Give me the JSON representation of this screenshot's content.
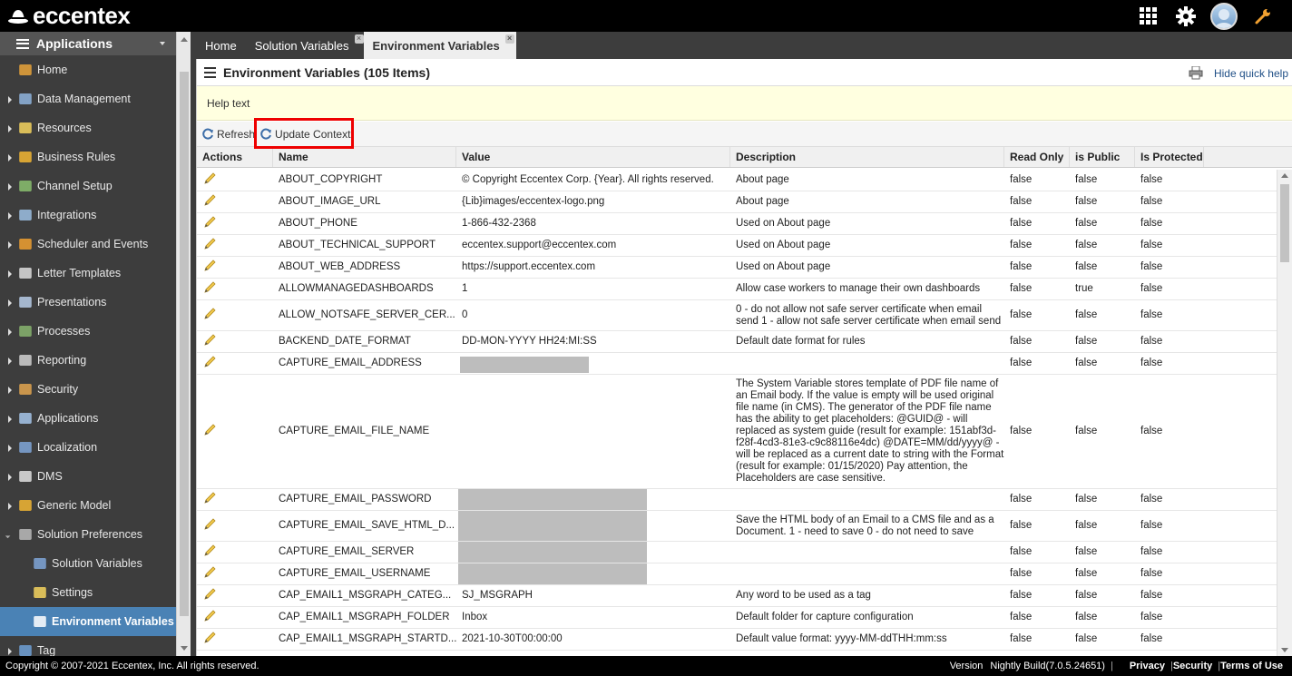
{
  "app": {
    "logo_text": "eccentex"
  },
  "sidebar": {
    "header": "Applications",
    "items": [
      {
        "label": "Home",
        "expandable": false
      },
      {
        "label": "Data Management",
        "expandable": true
      },
      {
        "label": "Resources",
        "expandable": true
      },
      {
        "label": "Business Rules",
        "expandable": true
      },
      {
        "label": "Channel Setup",
        "expandable": true
      },
      {
        "label": "Integrations",
        "expandable": true
      },
      {
        "label": "Scheduler and Events",
        "expandable": true
      },
      {
        "label": "Letter Templates",
        "expandable": true
      },
      {
        "label": "Presentations",
        "expandable": true
      },
      {
        "label": "Processes",
        "expandable": true
      },
      {
        "label": "Reporting",
        "expandable": true
      },
      {
        "label": "Security",
        "expandable": true
      },
      {
        "label": "Applications",
        "expandable": true
      },
      {
        "label": "Localization",
        "expandable": true
      },
      {
        "label": "DMS",
        "expandable": true
      },
      {
        "label": "Generic Model",
        "expandable": true
      },
      {
        "label": "Solution Preferences",
        "expandable": true
      },
      {
        "label": "Solution Variables",
        "sub": true
      },
      {
        "label": "Settings",
        "sub": true
      },
      {
        "label": "Environment Variables",
        "sub": true,
        "active": true
      },
      {
        "label": "Tag",
        "expandable": true
      }
    ]
  },
  "tabs": [
    {
      "label": "Home",
      "closable": false
    },
    {
      "label": "Solution Variables",
      "closable": true
    },
    {
      "label": "Environment Variables",
      "closable": true,
      "active": true
    }
  ],
  "main": {
    "title": "Environment Variables (105 Items)",
    "hide_help": "Hide quick help",
    "help_text": "Help text",
    "toolbar": {
      "refresh": "Refresh",
      "update_context": "Update Context"
    }
  },
  "table": {
    "columns": [
      "Actions",
      "Name",
      "Value",
      "Description",
      "Read Only",
      "is Public",
      "Is Protected"
    ],
    "rows": [
      {
        "name": "ABOUT_COPYRIGHT",
        "value": "© Copyright Eccentex Corp. {Year}. All rights reserved.",
        "desc": "About page",
        "ro": "false",
        "pub": "false",
        "prot": "false",
        "h": 24
      },
      {
        "name": "ABOUT_IMAGE_URL",
        "value": "{Lib}images/eccentex-logo.png",
        "desc": "About page",
        "ro": "false",
        "pub": "false",
        "prot": "false",
        "h": 24
      },
      {
        "name": "ABOUT_PHONE",
        "value": "1-866-432-2368",
        "desc": "Used on About page",
        "ro": "false",
        "pub": "false",
        "prot": "false",
        "h": 24
      },
      {
        "name": "ABOUT_TECHNICAL_SUPPORT",
        "value": "eccentex.support@eccentex.com",
        "desc": "Used on About page",
        "ro": "false",
        "pub": "false",
        "prot": "false",
        "h": 24
      },
      {
        "name": "ABOUT_WEB_ADDRESS",
        "value": "https://support.eccentex.com",
        "desc": "Used on About page",
        "ro": "false",
        "pub": "false",
        "prot": "false",
        "h": 24
      },
      {
        "name": "ALLOWMANAGEDASHBOARDS",
        "value": "1",
        "desc": "Allow case workers to manage their own dashboards",
        "ro": "false",
        "pub": "true",
        "prot": "false",
        "h": 24
      },
      {
        "name": "ALLOW_NOTSAFE_SERVER_CER...",
        "value": "0",
        "desc": "0 - do not allow not safe server certificate when email send 1 - allow not safe server certificate when email send",
        "ro": "false",
        "pub": "false",
        "prot": "false",
        "h": 34
      },
      {
        "name": "BACKEND_DATE_FORMAT",
        "value": "DD-MON-YYYY HH24:MI:SS",
        "desc": "Default date format for rules",
        "ro": "false",
        "pub": "false",
        "prot": "false",
        "h": 24
      },
      {
        "name": "CAPTURE_EMAIL_ADDRESS",
        "value": "",
        "desc": "",
        "ro": "false",
        "pub": "false",
        "prot": "false",
        "h": 24,
        "redact": "small"
      },
      {
        "name": "CAPTURE_EMAIL_FILE_NAME",
        "value": "",
        "desc": "The System Variable stores template of PDF file name of an Email body. If the value is empty will be used original file name (in CMS). The generator of the PDF file name has the ability to get placeholders: @GUID@ - will replaced as system guide (result for example: 151abf3d-f28f-4cd3-81e3-c9c88116e4dc) @DATE=MM/dd/yyyy@ - will be replaced as a current date to string with the Format (result for example: 01/15/2020) Pay attention, the Placeholders are case sensitive.",
        "ro": "false",
        "pub": "false",
        "prot": "false",
        "h": 126
      },
      {
        "name": "CAPTURE_EMAIL_PASSWORD",
        "value": "",
        "desc": "",
        "ro": "false",
        "pub": "false",
        "prot": "false",
        "h": 24,
        "redact": "big"
      },
      {
        "name": "CAPTURE_EMAIL_SAVE_HTML_D...",
        "value": "",
        "desc": "Save the HTML body of an Email to a CMS file and as a Document. 1 - need to save 0 - do not need to save",
        "ro": "false",
        "pub": "false",
        "prot": "false",
        "h": 34,
        "redact": "big"
      },
      {
        "name": "CAPTURE_EMAIL_SERVER",
        "value": "",
        "desc": "",
        "ro": "false",
        "pub": "false",
        "prot": "false",
        "h": 24,
        "redact": "big"
      },
      {
        "name": "CAPTURE_EMAIL_USERNAME",
        "value": "",
        "desc": "",
        "ro": "false",
        "pub": "false",
        "prot": "false",
        "h": 24,
        "redact": "big"
      },
      {
        "name": "CAP_EMAIL1_MSGRAPH_CATEG...",
        "value": "SJ_MSGRAPH",
        "desc": "Any word to be used as a tag",
        "ro": "false",
        "pub": "false",
        "prot": "false",
        "h": 24
      },
      {
        "name": "CAP_EMAIL1_MSGRAPH_FOLDER",
        "value": "Inbox",
        "desc": "Default folder for capture configuration",
        "ro": "false",
        "pub": "false",
        "prot": "false",
        "h": 24
      },
      {
        "name": "CAP_EMAIL1_MSGRAPH_STARTD...",
        "value": "2021-10-30T00:00:00",
        "desc": "Default value format: yyyy-MM-ddTHH:mm:ss",
        "ro": "false",
        "pub": "false",
        "prot": "false",
        "h": 24
      }
    ]
  },
  "footer": {
    "copyright": "Copyright © 2007-2021 Eccentex, Inc. All rights reserved.",
    "version_label": "Version",
    "version_value": "Nightly Build(7.0.5.24651)",
    "privacy": "Privacy",
    "security": "Security",
    "terms": "Terms of Use"
  },
  "colors": {
    "accent": "#4a82b5",
    "topbar": "#000000",
    "sidebar": "#3d3d3d",
    "highlight": "#ee0000"
  }
}
